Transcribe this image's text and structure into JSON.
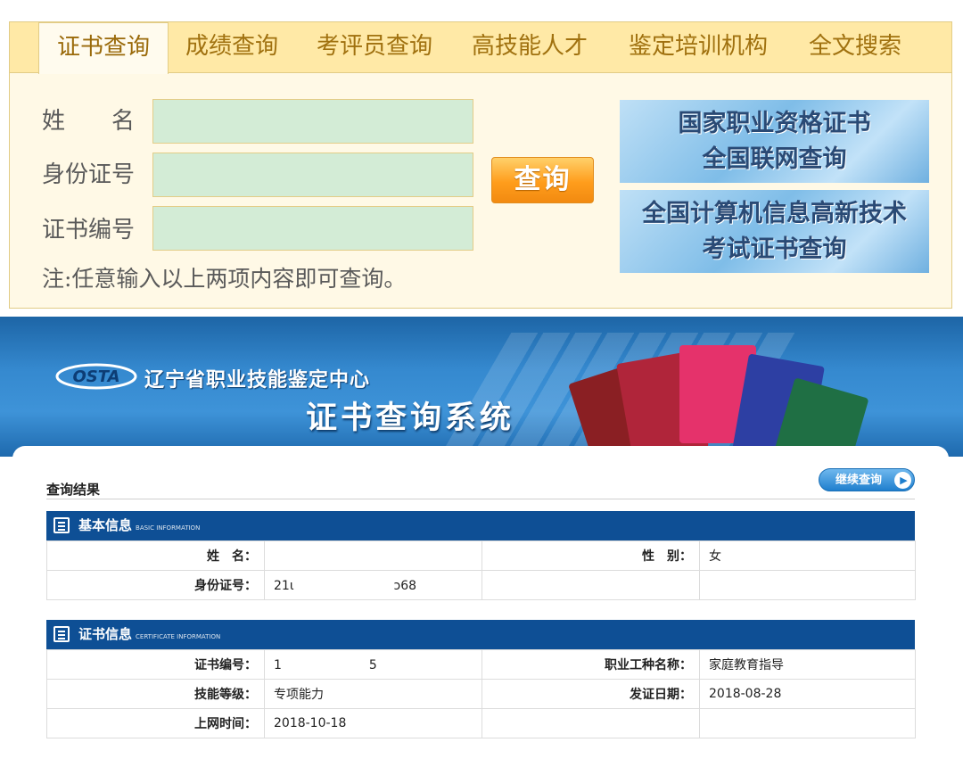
{
  "tabs": [
    {
      "label": "证书查询",
      "active": true
    },
    {
      "label": "成绩查询",
      "active": false
    },
    {
      "label": "考评员查询",
      "active": false
    },
    {
      "label": "高技能人才",
      "active": false
    },
    {
      "label": "鉴定培训机构",
      "active": false
    },
    {
      "label": "全文搜索",
      "active": false
    }
  ],
  "search_form": {
    "name_label": "姓　　名",
    "id_label": "身份证号",
    "cert_label": "证书编号",
    "name_value": "",
    "id_value": "",
    "cert_value": "",
    "query_button": "查询",
    "note": "注:任意输入以上两项内容即可查询。"
  },
  "promos": {
    "national": {
      "line1": "国家职业资格证书",
      "line2": "全国联网查询"
    },
    "computer": {
      "line1": "全国计算机信息高新技术",
      "line2": "考试证书查询"
    }
  },
  "banner": {
    "logo_text": "OSTA",
    "org_name": "辽宁省职业技能鉴定中心",
    "system_title": "证书查询系统"
  },
  "results": {
    "title": "查询结果",
    "continue_button": "继续查询",
    "basic": {
      "heading": "基本信息",
      "heading_en": "BASIC INFORMATION",
      "name_label": "姓　名：",
      "name_value": "",
      "gender_label": "性　别：",
      "gender_value": "女",
      "id_label": "身份证号：",
      "id_value": "21ι　　　　　　　　ɔ68"
    },
    "cert": {
      "heading": "证书信息",
      "heading_en": "CERTIFICATE INFORMATION",
      "cert_no_label": "证书编号：",
      "cert_no_value": "1　　　　　　　5",
      "occupation_label": "职业工种名称：",
      "occupation_value": "家庭教育指导",
      "level_label": "技能等级：",
      "level_value": "专项能力",
      "issue_date_label": "发证日期：",
      "issue_date_value": "2018-08-28",
      "online_time_label": "上网时间：",
      "online_time_value": "2018-10-18"
    }
  },
  "colors": {
    "tab_text": "#a0710f",
    "input_bg": "#d3ecd6",
    "query_button": "#ff9d1c",
    "banner_blue": "#3589cf",
    "section_header": "#0e4f95"
  },
  "icons": {
    "continue": "chevron-right-circle-icon",
    "basic_section": "document-list-icon",
    "cert_section": "certificate-icon"
  }
}
